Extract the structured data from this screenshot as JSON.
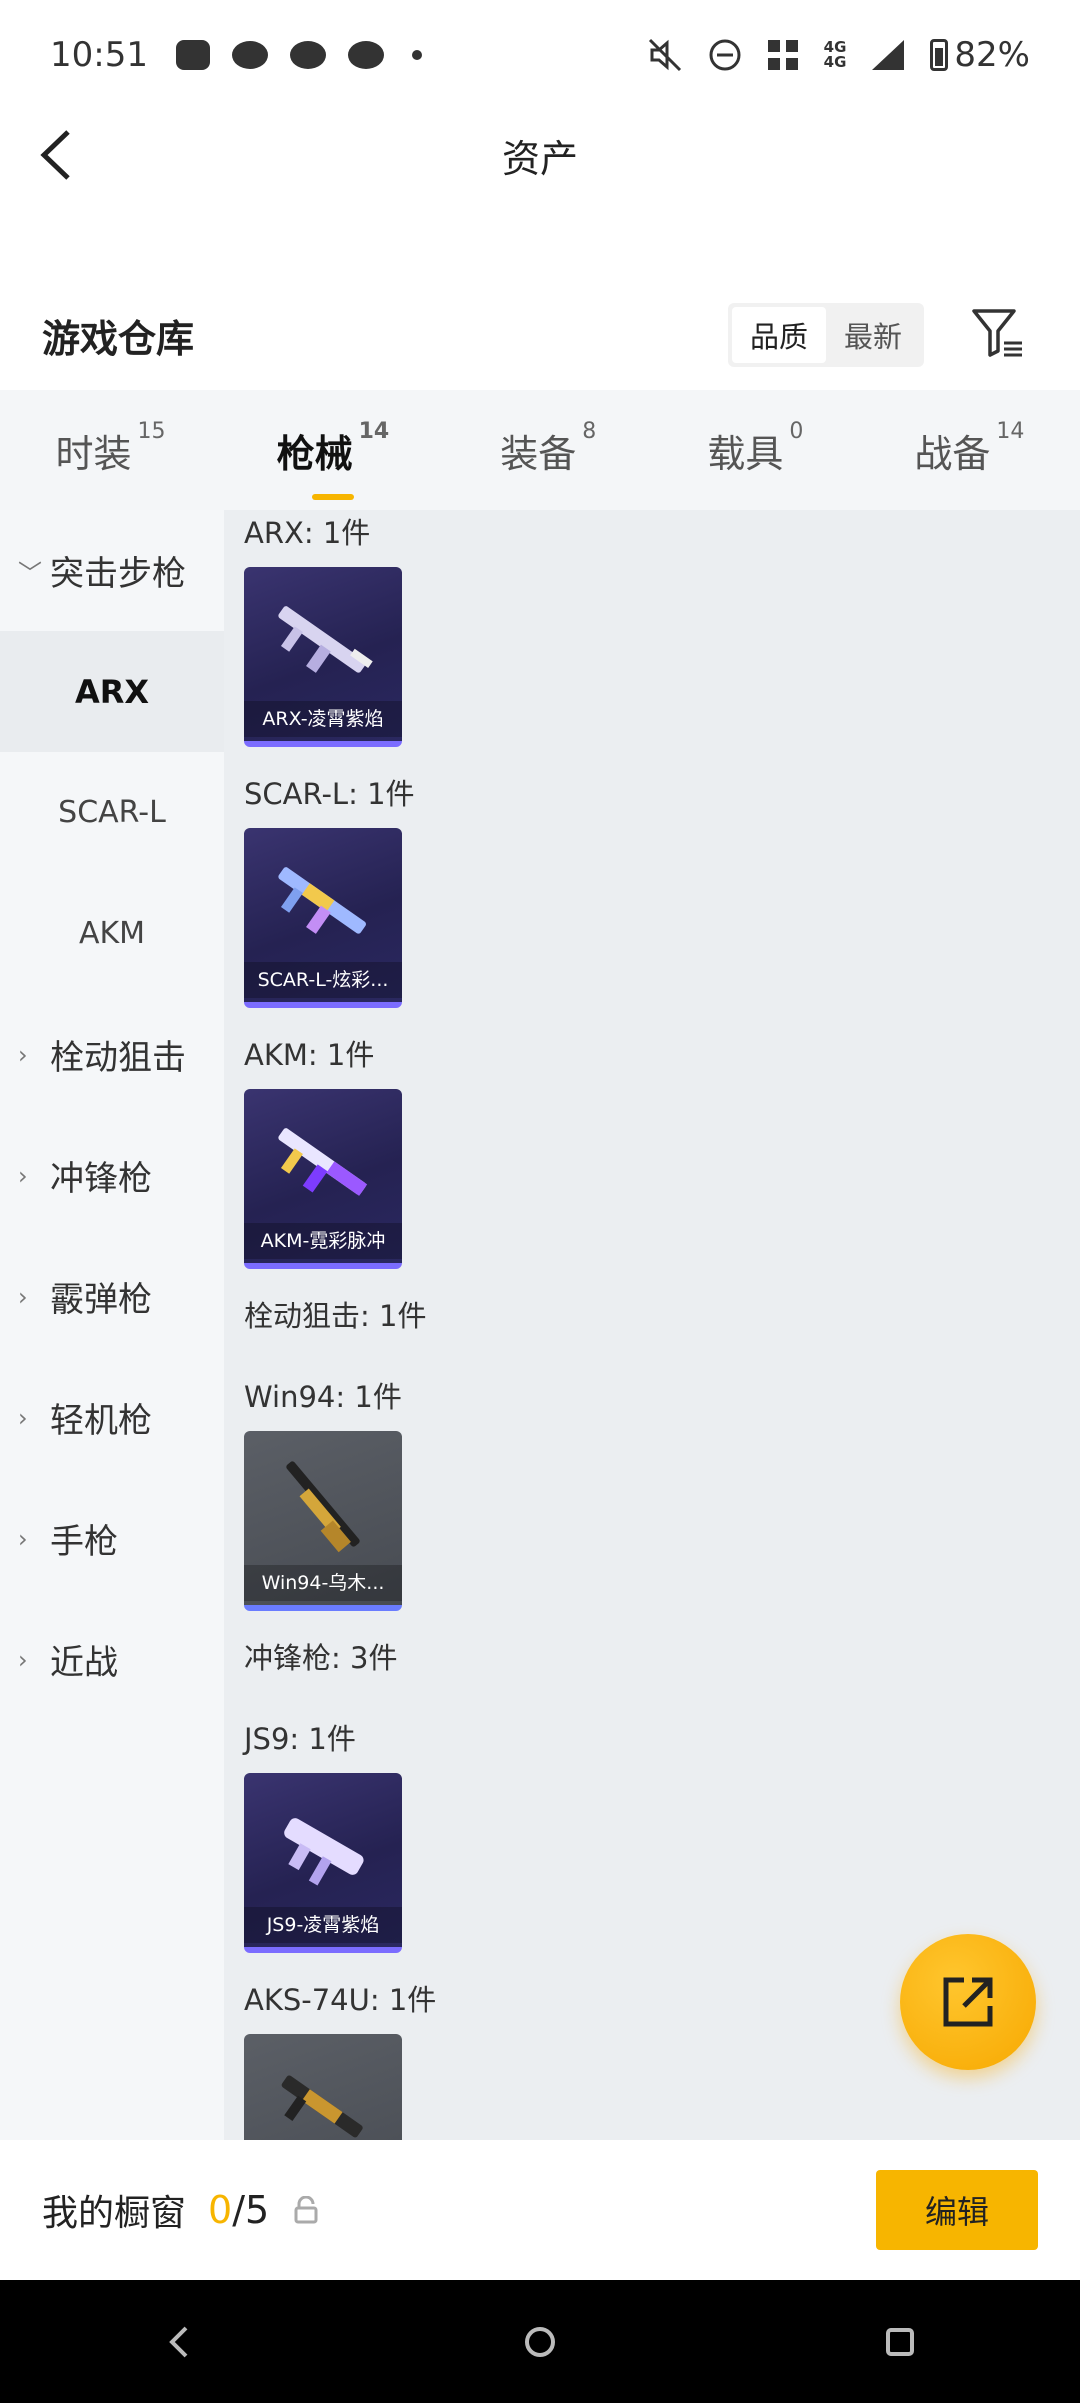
{
  "status_bar": {
    "time": "10:51",
    "battery": "82%",
    "net1": "4G",
    "net2": "4G"
  },
  "header": {
    "title": "资产"
  },
  "section": {
    "title": "游戏仓库",
    "sort_options": [
      "品质",
      "最新"
    ],
    "active_sort": "品质"
  },
  "tabs": [
    {
      "label": "时装",
      "count": "15"
    },
    {
      "label": "枪械",
      "count": "14",
      "active": true
    },
    {
      "label": "装备",
      "count": "8"
    },
    {
      "label": "载具",
      "count": "0"
    },
    {
      "label": "战备",
      "count": "14"
    }
  ],
  "sidebar": {
    "items": [
      {
        "label": "突击步枪",
        "type": "category",
        "expanded": true
      },
      {
        "label": "ARX",
        "type": "sub",
        "active": true
      },
      {
        "label": "SCAR-L",
        "type": "sub"
      },
      {
        "label": "AKM",
        "type": "sub"
      },
      {
        "label": "栓动狙击",
        "type": "category"
      },
      {
        "label": "冲锋枪",
        "type": "category"
      },
      {
        "label": "霰弹枪",
        "type": "category"
      },
      {
        "label": "轻机枪",
        "type": "category"
      },
      {
        "label": "手枪",
        "type": "category"
      },
      {
        "label": "近战",
        "type": "category"
      }
    ]
  },
  "content": {
    "labels": {
      "arx": "ARX: 1件",
      "scar": "SCAR-L: 1件",
      "akm": "AKM: 1件",
      "sniper": "栓动狙击: 1件",
      "win94": "Win94: 1件",
      "smg": "冲锋枪: 3件",
      "js9": "JS9: 1件",
      "aks": "AKS-74U: 1件"
    },
    "cards": {
      "arx": "ARX-凌霄紫焰",
      "scar": "SCAR-L-炫彩...",
      "akm": "AKM-霓彩脉冲",
      "win94": "Win94-乌木...",
      "js9": "JS9-凌霄紫焰",
      "aks": ""
    }
  },
  "showcase": {
    "label": "我的橱窗",
    "current": "0",
    "total": "/5",
    "edit_label": "编辑"
  },
  "colors": {
    "accent": "#f7b500",
    "card_purple": "#252252",
    "card_gray": "#474b52"
  }
}
